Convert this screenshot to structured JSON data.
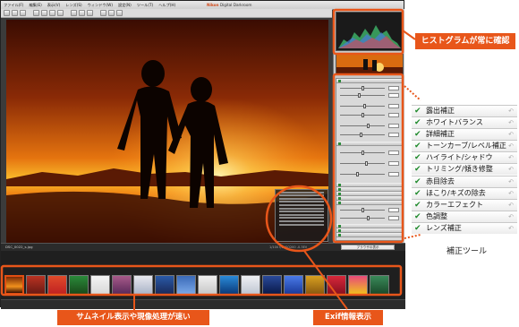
{
  "app": {
    "title_brand": "Nikon",
    "title_rest": " Digital Darkroom",
    "menus": [
      "ファイル(F)",
      "編集(E)",
      "表示(V)",
      "レンズ(S)",
      "ウィンドウ(W)",
      "設定(N)",
      "ツール(T)",
      "ヘルプ(H)"
    ]
  },
  "statusbar": {
    "filename": "DSC_0022_s.jpg",
    "info": "1/100   f/8   ISO200   -0.3EV",
    "browser_button": "ブラウザの表示"
  },
  "callouts": {
    "histogram": "ヒストグラムが常に確認",
    "thumbnail": "サムネイル表示や現像処理が速い",
    "exif": "Exif情報表示"
  },
  "correction_tools": {
    "items": [
      "露出補正",
      "ホワイトバランス",
      "詳細補正",
      "トーンカーブ/レベル補正",
      "ハイライト/シャドウ",
      "トリミング/傾き修整",
      "赤目除去",
      "ほこり/キズの除去",
      "カラーエフェクト",
      "色調整",
      "レンズ補正"
    ],
    "caption": "補正ツール"
  },
  "colors": {
    "accent": "#e8561a",
    "check": "#1f8a2c"
  },
  "icons": {
    "check": "check-icon",
    "undo": "undo-icon"
  }
}
